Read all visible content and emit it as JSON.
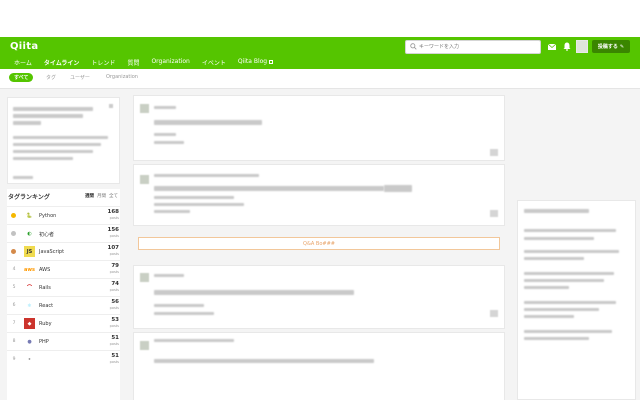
{
  "header": {
    "logo": "Qiita",
    "nav": [
      "ホーム",
      "タイムライン",
      "トレンド",
      "質問",
      "Organization",
      "イベント",
      "Qiita Blog"
    ],
    "active_nav_index": 1,
    "search_placeholder": "キーワードを入力",
    "post_button": "投稿する",
    "brand_color": "#55c500"
  },
  "subtabs": {
    "items": [
      "すべて",
      "タグ",
      "ユーザー",
      "Organization"
    ],
    "active_index": 0
  },
  "qa_banner": "Q&A Bo###",
  "ranking": {
    "title": "タグランキング",
    "periods": [
      "週間",
      "月間",
      "全て"
    ],
    "active_period_index": 0,
    "unit": "posts",
    "rows": [
      {
        "rank": "1",
        "tag": "Python",
        "count": "168",
        "icon": "python-icon"
      },
      {
        "rank": "2",
        "tag": "初心者",
        "count": "156",
        "icon": "beginner-icon"
      },
      {
        "rank": "3",
        "tag": "JavaScript",
        "count": "107",
        "icon": "javascript-icon"
      },
      {
        "rank": "4",
        "tag": "AWS",
        "count": "79",
        "icon": "aws-icon"
      },
      {
        "rank": "5",
        "tag": "Rails",
        "count": "74",
        "icon": "rails-icon"
      },
      {
        "rank": "6",
        "tag": "React",
        "count": "56",
        "icon": "react-icon"
      },
      {
        "rank": "7",
        "tag": "Ruby",
        "count": "53",
        "icon": "ruby-icon"
      },
      {
        "rank": "8",
        "tag": "PHP",
        "count": "51",
        "icon": "php-icon"
      },
      {
        "rank": "9",
        "tag": "",
        "count": "51",
        "icon": "tag-icon"
      }
    ]
  }
}
